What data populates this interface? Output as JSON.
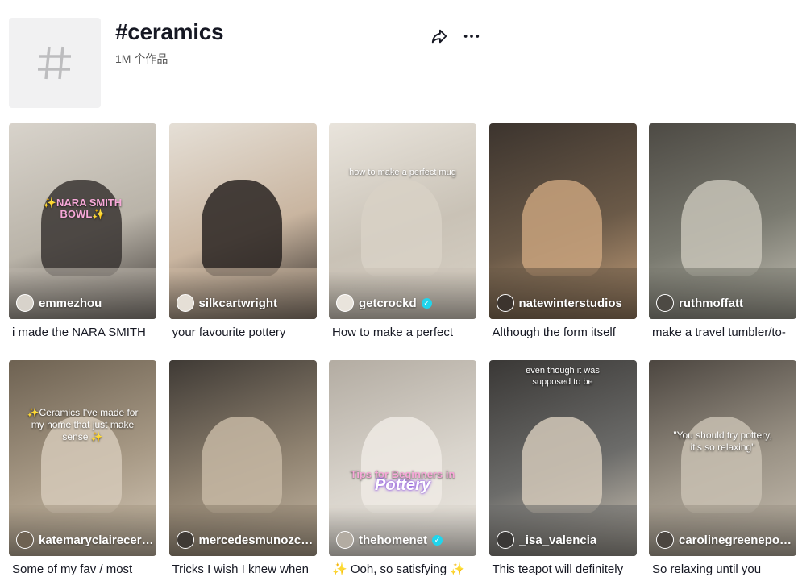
{
  "header": {
    "title": "#ceramics",
    "count": "1M 个作品",
    "icons": {
      "tag": "hashtag-icon",
      "share": "share-icon",
      "more": "more-icon"
    }
  },
  "videos": [
    {
      "author": "emmezhou",
      "verified": false,
      "caption": "i made the NARA SMITH",
      "overlay": "✨NARA SMITH BOWL✨",
      "colors": [
        "#b9b3a8",
        "#3a3532",
        "#d8d3cb"
      ]
    },
    {
      "author": "silkcartwright",
      "verified": false,
      "caption": "your favourite pottery",
      "overlay": "",
      "colors": [
        "#c9b5a0",
        "#2a2522",
        "#e5dfd6"
      ]
    },
    {
      "author": "getcrockd",
      "verified": true,
      "caption": "How to make a perfect",
      "overlay": "how to make a perfect mug",
      "colors": [
        "#c9c2b6",
        "#d8d1c5",
        "#e9e4dc"
      ]
    },
    {
      "author": "natewinterstudios",
      "verified": false,
      "caption": "Although the form itself",
      "overlay": "",
      "colors": [
        "#6b5a48",
        "#c8a27c",
        "#3c342e"
      ]
    },
    {
      "author": "ruthmoffatt",
      "verified": false,
      "caption": "make a travel tumbler/to-",
      "overlay": "",
      "colors": [
        "#7a7a70",
        "#c7c3b7",
        "#4d4a44"
      ]
    },
    {
      "author": "katemaryclaireceramics",
      "verified": false,
      "caption": "Some of my fav / most",
      "overlay": "✨Ceramics I've made for my home that just make sense ✨",
      "colors": [
        "#a79985",
        "#d5c9b8",
        "#6e6252"
      ]
    },
    {
      "author": "mercedesmunozceramics",
      "verified": false,
      "caption": "Tricks I wish I knew when",
      "overlay": "",
      "colors": [
        "#8f8270",
        "#c5b7a3",
        "#3f3a35"
      ]
    },
    {
      "author": "thehomenet",
      "verified": true,
      "caption": "✨ Ooh, so satisfying ✨",
      "overlay": "Tips for Beginners in",
      "overlay2": "Pottery",
      "colors": [
        "#d9d4cc",
        "#eeeae4",
        "#b3aca2"
      ]
    },
    {
      "author": "_isa_valencia",
      "verified": false,
      "caption": "This teapot will definitely",
      "overlay": "even though it was supposed to be",
      "colors": [
        "#6c6c6a",
        "#d2c8b8",
        "#3a3836"
      ]
    },
    {
      "author": "carolinegreenepottery",
      "verified": false,
      "caption": "So relaxing until you",
      "overlay": "\"You should try pottery, it's so relaxing\"",
      "colors": [
        "#9c9487",
        "#c8bfb1",
        "#4c4640"
      ]
    }
  ]
}
